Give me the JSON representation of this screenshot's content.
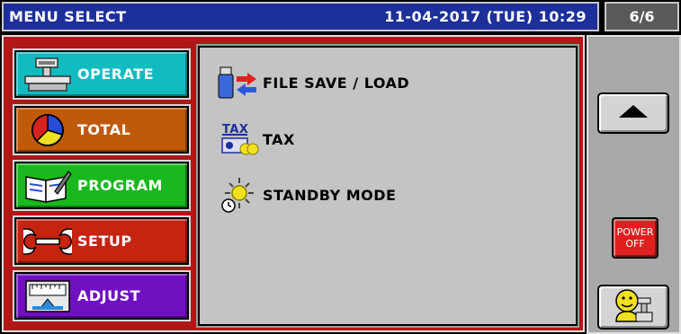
{
  "header": {
    "title": "MENU SELECT",
    "datetime": "11-04-2017 (TUE) 10:29",
    "page": "6/6"
  },
  "menu": {
    "operate": {
      "label": "OPERATE",
      "icon": "scale-icon",
      "color": "#10bcc0"
    },
    "total": {
      "label": "TOTAL",
      "icon": "pie-chart-icon",
      "color": "#c05a08"
    },
    "program": {
      "label": "PROGRAM",
      "icon": "book-pen-icon",
      "color": "#1ab81e"
    },
    "setup": {
      "label": "SETUP",
      "icon": "wrench-icon",
      "color": "#c42410"
    },
    "adjust": {
      "label": "ADJUST",
      "icon": "calibration-icon",
      "color": "#7010c0"
    }
  },
  "items": {
    "file": {
      "label": "FILE SAVE / LOAD",
      "icon": "usb-transfer-icon"
    },
    "tax": {
      "label": "TAX",
      "icon": "tax-icon"
    },
    "standby": {
      "label": "STANDBY MODE",
      "icon": "sun-clock-icon"
    }
  },
  "side": {
    "up_icon": "triangle-up-icon",
    "power_line1": "POWER",
    "power_line2": "OFF",
    "operator_icon": "operator-icon"
  }
}
